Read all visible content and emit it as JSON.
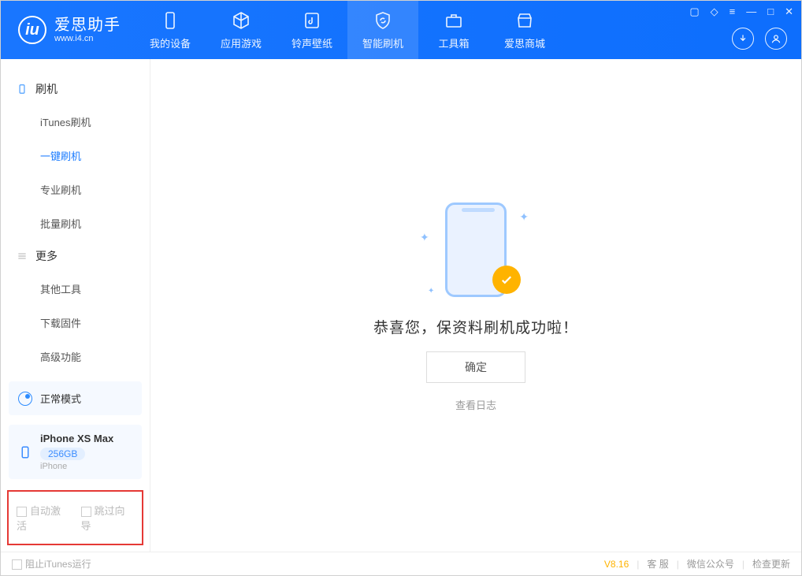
{
  "app": {
    "name": "爱思助手",
    "url": "www.i4.cn"
  },
  "nav": {
    "device": "我的设备",
    "apps": "应用游戏",
    "ringtone": "铃声壁纸",
    "flash": "智能刷机",
    "toolbox": "工具箱",
    "store": "爱思商城"
  },
  "sidebar": {
    "section1": "刷机",
    "items1": {
      "itunes": "iTunes刷机",
      "oneclick": "一键刷机",
      "pro": "专业刷机",
      "batch": "批量刷机"
    },
    "section2": "更多",
    "items2": {
      "other": "其他工具",
      "firmware": "下载固件",
      "advanced": "高级功能"
    }
  },
  "mode": {
    "label": "正常模式"
  },
  "device": {
    "name": "iPhone XS Max",
    "capacity": "256GB",
    "type": "iPhone"
  },
  "options": {
    "auto_activate": "自动激活",
    "skip_guide": "跳过向导"
  },
  "main": {
    "message": "恭喜您，保资料刷机成功啦！",
    "ok": "确定",
    "view_log": "查看日志"
  },
  "footer": {
    "block_itunes": "阻止iTunes运行",
    "version": "V8.16",
    "support": "客 服",
    "wechat": "微信公众号",
    "update": "检查更新"
  }
}
